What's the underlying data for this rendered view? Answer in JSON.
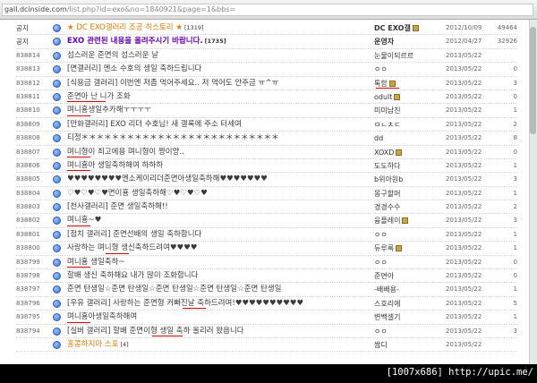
{
  "address": {
    "host": "gall.dcinside.com",
    "path": "/list.php?id=exo&no=1840921&page=1&bbs="
  },
  "rows": [
    {
      "num": "공지",
      "title": "★ DC EXO갤러리 조공 히스토리 ★",
      "comments": "[1319]",
      "author": "DC EXO갤",
      "date": "2012/10/09",
      "views": "49464",
      "kind": "notice-orange",
      "gl": true
    },
    {
      "num": "공지",
      "title": "EXO 관련된 내용을 올려주시기 바랍니다.",
      "comments": "[1735]",
      "author": "운영자",
      "date": "2012/04/27",
      "views": "32926",
      "kind": "notice-purple",
      "gl": false
    },
    {
      "num": "838814",
      "title": "섬스러운 준면의 섬스러운 날",
      "comments": "",
      "author": "눈물이되르르",
      "date": "2013/05/22",
      "views": "",
      "kind": "post",
      "gl": false
    },
    {
      "num": "838813",
      "title": "[면갤러리] 멘소 수호의 생일 축하드립니다",
      "comments": "",
      "author": "ㅇㅇ",
      "date": "2013/05/22",
      "views": "0",
      "kind": "post",
      "gl": false
    },
    {
      "num": "838812",
      "title": "[식용금 갤러리] 이번엔 저좀 먹어주세요.. 저 먹어도 안주금 ㅠ^ㅠ",
      "comments": "",
      "author": "톡함",
      "date": "2013/05/22",
      "views": "3",
      "kind": "post",
      "gl": true
    },
    {
      "num": "838811",
      "title": "준면아 난 니가 조화",
      "comments": "",
      "author": "odult",
      "date": "2013/05/22",
      "views": "0",
      "kind": "post",
      "gl": true
    },
    {
      "num": "838810",
      "title": "며니횽생일추카해ㅜㅜㅜㅜ",
      "comments": "",
      "author": "미미남친",
      "date": "2013/05/22",
      "views": "1",
      "kind": "post",
      "gl": false
    },
    {
      "num": "838809",
      "title": "[만화갤러리] EXO 리더 수호님! 새 갤록에 주소 터세여",
      "comments": "",
      "author": "ㅁㄴㅊㄷ",
      "date": "2013/05/22",
      "views": "2",
      "kind": "post",
      "gl": false
    },
    {
      "num": "838808",
      "title": "티정＊＊＊＊＊＊＊＊＊＊＊＊＊＊＊＊＊＊＊＊＊＊＊＊＊＊",
      "comments": "",
      "author": "dd",
      "date": "2013/05/22",
      "views": "8",
      "kind": "post",
      "gl": false
    },
    {
      "num": "838807",
      "title": "며니형이 최고에용 며니형이 짱이양..",
      "comments": "",
      "author": "XOXD",
      "date": "2013/05/22",
      "views": "0",
      "kind": "post",
      "gl": true
    },
    {
      "num": "838806",
      "title": "며니횽아 생일축하해여 하하하",
      "comments": "",
      "author": "도도하다",
      "date": "2013/05/22",
      "views": "1",
      "kind": "post",
      "gl": false
    },
    {
      "num": "838805",
      "title": "♥♥♥♥♥♥♥♥멘소케이리더준면아생일축하해♥♥♥♥♥♥♥",
      "comments": "",
      "author": "b위아원b",
      "date": "2013/05/22",
      "views": "3",
      "kind": "post",
      "gl": false
    },
    {
      "num": "838804",
      "title": "♡♥♡♥♡♥면이횽 생일축하해♡♥♡♥♡♥",
      "comments": "",
      "author": "몽구할머",
      "date": "2013/05/22",
      "views": "1",
      "kind": "post",
      "gl": false
    },
    {
      "num": "838803",
      "title": "[천사갤러리] 준면 생일축하해!!",
      "comments": "",
      "author": "경경수수",
      "date": "2013/05/22",
      "views": "2",
      "kind": "post",
      "gl": false
    },
    {
      "num": "838802",
      "title": "며니횽~♥",
      "comments": "",
      "author": "융플레이",
      "date": "2013/05/22",
      "views": "3",
      "kind": "post",
      "gl": true
    },
    {
      "num": "838801",
      "title": "[점치 갤러리] 준면선배의 생일 축하합니다",
      "comments": "",
      "author": "ㅇㅇ",
      "date": "2013/05/22",
      "views": "1",
      "kind": "post",
      "gl": false
    },
    {
      "num": "838800",
      "title": "사랑하는 며니형 생신축하드려여♥♥♥♥",
      "comments": "",
      "author": "듀루룩",
      "date": "2013/05/22",
      "views": "1",
      "kind": "post",
      "gl": true
    },
    {
      "num": "838799",
      "title": "며니횽 생일축하~",
      "comments": "",
      "author": "ㅇㅇ",
      "date": "2013/05/22",
      "views": "0",
      "kind": "post",
      "gl": false
    },
    {
      "num": "838798",
      "title": "할배 생신 축하해요 내가 많이 조화합니다",
      "comments": "",
      "author": "준면아",
      "date": "2013/05/22",
      "views": "0",
      "kind": "post",
      "gl": false
    },
    {
      "num": "838797",
      "title": "준면 탄생일☆준면 탄생일☆준면 탄생일☆준면 탄생일☆준면 탄생일",
      "comments": "",
      "author": "-배배용-",
      "date": "2013/05/22",
      "views": "1",
      "kind": "post",
      "gl": false
    },
    {
      "num": "838796",
      "title": "[우유 갤러리] 사랑하는 준면형 커빠진날 축하드려여!♥♥♥♥♥♥♥♥♥♥",
      "comments": "",
      "author": "스호리에",
      "date": "2013/05/22",
      "views": "5",
      "kind": "post",
      "gl": false
    },
    {
      "num": "838795",
      "title": "며니횽아생일축하해여",
      "comments": "",
      "author": "변백셀기",
      "date": "2013/05/22",
      "views": "1",
      "kind": "post",
      "gl": false
    },
    {
      "num": "838794",
      "title": "[실버 갤러리] 할배 준면이형 생일 축하 올리러 왔읍니다",
      "comments": "",
      "author": "ㅇㅇ",
      "date": "2013/05/22",
      "views": "3",
      "kind": "post",
      "gl": false
    },
    {
      "num": "",
      "title": "홍콩하지마 스포",
      "comments": "[4]",
      "author": "쌈디",
      "date": "2013/05/22",
      "views": "",
      "kind": "cutoff",
      "gl": false
    }
  ],
  "underlines": [
    {
      "row": 4,
      "field": "author"
    },
    {
      "row": 5,
      "field": "title_start",
      "chars": 5
    },
    {
      "row": 6,
      "field": "title_start",
      "chars": 3
    },
    {
      "row": 9,
      "field": "title_start",
      "chars": 3
    },
    {
      "row": 10,
      "field": "title_start",
      "chars": 3
    },
    {
      "row": 14,
      "field": "title_start",
      "chars": 3
    },
    {
      "row": 16,
      "field": "title_mid",
      "chars": 3
    },
    {
      "row": 17,
      "field": "title_start",
      "chars": 3
    },
    {
      "row": 20,
      "field": "title_mid2",
      "chars": 3
    },
    {
      "row": 21,
      "field": "title_start",
      "chars": 3
    },
    {
      "row": 22,
      "field": "title_mid3",
      "chars": 4
    }
  ],
  "stamp": "[1007x686] http://upic.me/"
}
